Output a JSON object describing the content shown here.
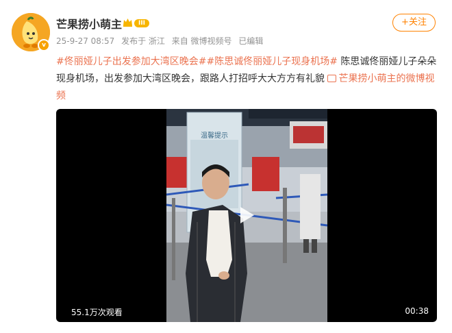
{
  "author": {
    "name": "芒果捞小萌主",
    "level_badge": "III",
    "avatar_badge": "v"
  },
  "meta": {
    "time": "25-9-27 08:57",
    "location": "发布于 浙江",
    "source": "来自 微博视频号",
    "edited": "已编辑"
  },
  "follow_label": "+关注",
  "post": {
    "tag1": "#佟丽娅儿子出发参加大湾区晚会#",
    "tag2": "#陈思诚佟丽娅儿子现身机场#",
    "body": " 陈思诚佟丽娅儿子朵朵现身机场，出发参加大湾区晚会，跟路人打招呼大大方方有礼貌 ",
    "link": "芒果捞小萌主的微博视频"
  },
  "video": {
    "views": "55.1万次观看",
    "duration": "00:38",
    "sign_text": "温馨提示"
  },
  "colors": {
    "accent": "#ff8200",
    "tag": "#eb7350"
  }
}
